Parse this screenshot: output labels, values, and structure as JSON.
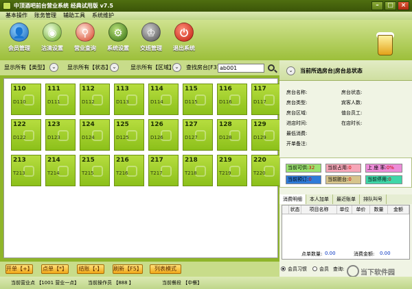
{
  "window": {
    "title": "中顶酒吧前台营业系统 经典试用版 v7.5"
  },
  "menu": [
    "基本操作",
    "账务管理",
    "辅助工具",
    "系统维护"
  ],
  "toolbar": {
    "items": [
      {
        "label": "会员管理",
        "icon": "member-icon"
      },
      {
        "label": "沽清设置",
        "icon": "dish-icon"
      },
      {
        "label": "营业查询",
        "icon": "search-icon"
      },
      {
        "label": "系统设置",
        "icon": "gear-icon"
      },
      {
        "label": "交班管理",
        "icon": "handover-icon"
      },
      {
        "label": "退出系统",
        "icon": "power-icon"
      }
    ]
  },
  "filters": {
    "type_label": "显示所有【类型】",
    "state_label": "显示所有【状态】",
    "area_label": "显示所有【区域】",
    "find_label": "查找房台[F3]",
    "find_value": "ab001"
  },
  "rooms": [
    {
      "no": "110",
      "code": "D110"
    },
    {
      "no": "111",
      "code": "D111"
    },
    {
      "no": "112",
      "code": "D112"
    },
    {
      "no": "113",
      "code": "D113"
    },
    {
      "no": "114",
      "code": "D114"
    },
    {
      "no": "115",
      "code": "D115"
    },
    {
      "no": "116",
      "code": "D116"
    },
    {
      "no": "117",
      "code": "D117"
    },
    {
      "no": "122",
      "code": "D122"
    },
    {
      "no": "123",
      "code": "D123"
    },
    {
      "no": "124",
      "code": "D124"
    },
    {
      "no": "125",
      "code": "D125"
    },
    {
      "no": "126",
      "code": "D126"
    },
    {
      "no": "127",
      "code": "D127"
    },
    {
      "no": "128",
      "code": "D128"
    },
    {
      "no": "129",
      "code": "D129"
    },
    {
      "no": "213",
      "code": "T213"
    },
    {
      "no": "214",
      "code": "T214"
    },
    {
      "no": "215",
      "code": "T215"
    },
    {
      "no": "216",
      "code": "T216"
    },
    {
      "no": "217",
      "code": "T217"
    },
    {
      "no": "218",
      "code": "T218"
    },
    {
      "no": "219",
      "code": "T219"
    },
    {
      "no": "220",
      "code": "T220"
    }
  ],
  "actions": [
    "开单【+】",
    "点单【*】",
    "结账【-】",
    "刷新【F5】",
    "列表模式"
  ],
  "right": {
    "title": "当前所选房台|房台总状态",
    "fields_left": [
      "房台名称:",
      "房台类型:",
      "房台区域:",
      "进店时间:",
      "最低消费:",
      "开单备注:"
    ],
    "fields_right": [
      "房台状态:",
      "宾客人数:",
      "值台员工:",
      "在店时长:"
    ],
    "status": [
      {
        "label": "当前可供:",
        "value": "32",
        "color": "#9ae26f"
      },
      {
        "label": "当前占用:",
        "value": "0",
        "color": "#f6a6b8"
      },
      {
        "label": "上 座 率:",
        "value": "0%",
        "color": "#ec8cd8"
      },
      {
        "label": "当前预订:",
        "value": "0",
        "color": "#2f7bd8"
      },
      {
        "label": "当前脏台:",
        "value": "0",
        "color": "#d6c48c"
      },
      {
        "label": "当前停用:",
        "value": "0",
        "color": "#3fd6a8"
      }
    ],
    "tabs": [
      "消费明细",
      "本人加单",
      "最近账单",
      "排队叫号"
    ],
    "table_headers": [
      "状态",
      "项目名称",
      "单位",
      "单价",
      "数量",
      "金额"
    ],
    "dish_count_label": "点单数量:",
    "dish_count": "0.00",
    "amount_label": "消费金额:",
    "amount": "0.00",
    "radio_member": "会员习惯",
    "radio_guest": "会员",
    "query_label": "查询:"
  },
  "statusbar": {
    "point": "当前营业点 【1001 营业一点】",
    "operator": "当前操作员 【888 】",
    "meal": "当前餐段 【中餐】"
  },
  "watermark": {
    "text": "当下软件园"
  }
}
